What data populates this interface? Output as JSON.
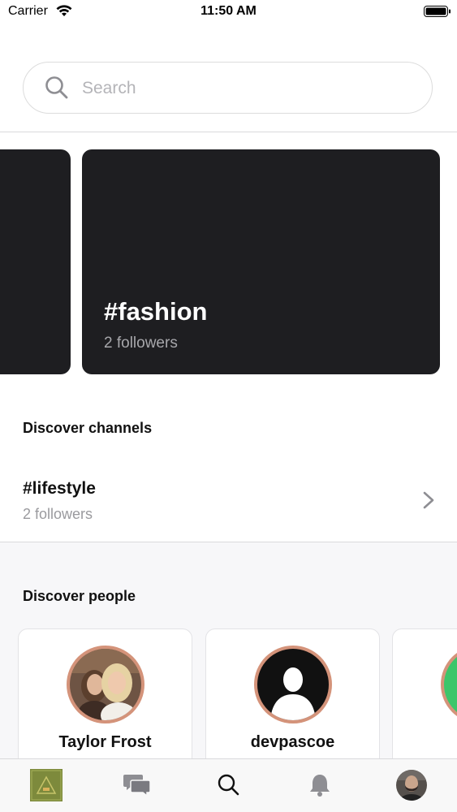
{
  "status_bar": {
    "carrier": "Carrier",
    "time": "11:50 AM"
  },
  "search": {
    "placeholder": "Search",
    "value": ""
  },
  "trending": {
    "cards": [
      {
        "title": "",
        "followers": ""
      },
      {
        "title": "#fashion",
        "followers": "2 followers"
      }
    ]
  },
  "discover_channels": {
    "title": "Discover channels",
    "items": [
      {
        "name": "#lifestyle",
        "followers": "2 followers"
      }
    ]
  },
  "discover_people": {
    "title": "Discover people",
    "people": [
      {
        "name": "Taylor Frost"
      },
      {
        "name": "devpascoe"
      },
      {
        "name": ""
      }
    ]
  },
  "tab_bar": {
    "tabs": [
      "home-icon",
      "messages-icon",
      "search-icon",
      "bell-icon",
      "profile-avatar"
    ]
  },
  "colors": {
    "card_background": "#1e1e21",
    "avatar_ring": "#d4937a",
    "muted_text": "#9a9a9e",
    "people_background": "#f7f7f9"
  }
}
